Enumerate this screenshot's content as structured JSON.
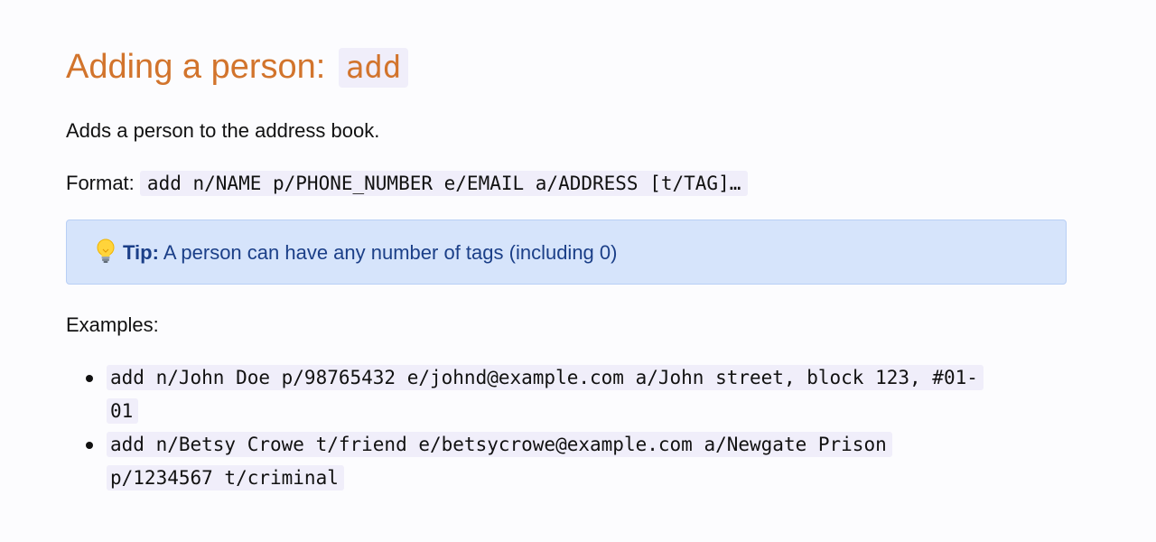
{
  "heading": {
    "text": "Adding a person:",
    "command": "add"
  },
  "description": "Adds a person to the address book.",
  "format": {
    "label": "Format:",
    "code": "add n/NAME p/PHONE_NUMBER e/EMAIL a/ADDRESS [t/TAG]…"
  },
  "tip": {
    "icon": "lightbulb-icon",
    "label": "Tip:",
    "text": "A person can have any number of tags (including 0)"
  },
  "examples": {
    "label": "Examples:",
    "items": [
      {
        "line1": "add n/John Doe p/98765432 e/johnd@example.com a/John street, block 123, #01-",
        "line2": "01"
      },
      {
        "line1": "add n/Betsy Crowe t/friend e/betsycrowe@example.com a/Newgate Prison",
        "line2": "p/1234567 t/criminal"
      }
    ]
  },
  "colors": {
    "heading": "#d2742c",
    "code_background": "#f0eefa",
    "tip_background": "#d6e4fb",
    "tip_text": "#1b3f88"
  }
}
